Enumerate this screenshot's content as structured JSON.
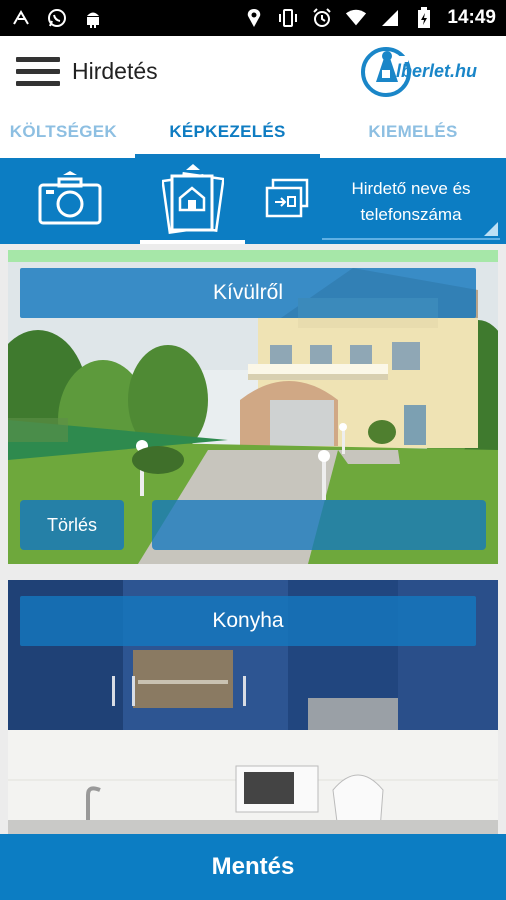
{
  "status_bar": {
    "time": "14:49",
    "icons": [
      "ksweb-icon",
      "whatsapp-icon",
      "android-icon",
      "location-icon",
      "vibrate-icon",
      "alarm-icon",
      "wifi-icon",
      "signal-icon",
      "battery-icon"
    ]
  },
  "app_bar": {
    "title": "Hirdetés",
    "logo_text": "lberlet.hu"
  },
  "tabs": [
    {
      "label": "KÖLTSÉGEK",
      "active": false
    },
    {
      "label": "KÉPKEZELÉS",
      "active": true
    },
    {
      "label": "KIEMELÉS",
      "active": false
    }
  ],
  "toolbar": {
    "owner_select": {
      "line1": "Hirdető neve és",
      "line2": "telefonszáma"
    }
  },
  "photos": [
    {
      "caption": "Kívülről",
      "delete_label": "Törlés"
    },
    {
      "caption": "Konyha"
    }
  ],
  "save_label": "Mentés",
  "colors": {
    "primary": "#0c7dc3",
    "tab_inactive": "#8dbfe2",
    "progress": "#a6e7a8"
  }
}
